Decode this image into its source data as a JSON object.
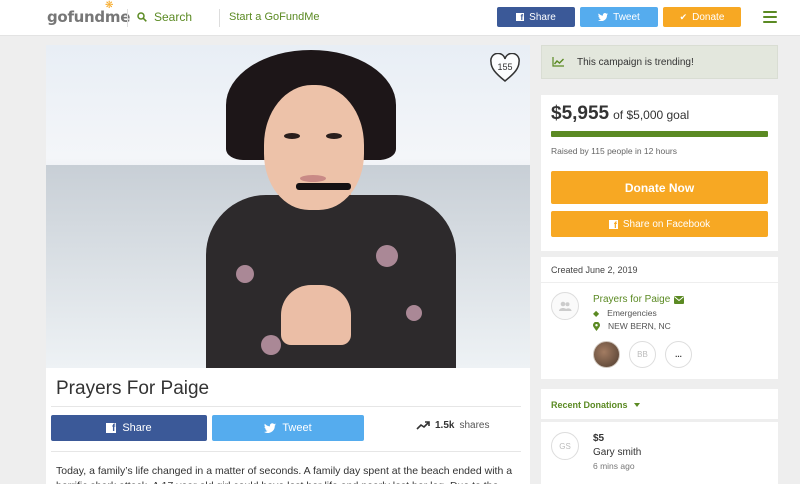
{
  "header": {
    "logo": "gofundme",
    "search_label": "Search",
    "start_label": "Start a GoFundMe",
    "share_label": "Share",
    "tweet_label": "Tweet",
    "donate_label": "Donate"
  },
  "campaign": {
    "heart_count": "155",
    "title": "Prayers For Paige",
    "share_label": "Share",
    "tweet_label": "Tweet",
    "shares_count": "1.5k",
    "shares_label": "shares",
    "story": "Today, a family’s life changed in a matter of seconds. A family day spent at the beach ended with a horrific shark attack. A 17 year old girl could have lost her life and nearly lost her leg. Due to the"
  },
  "sidebar": {
    "trending": "This campaign is trending!",
    "raised_amount": "$5,955",
    "goal_text": "of $5,000 goal",
    "progress_fraction": 1.0,
    "raised_by": "Raised by 115 people in 12 hours",
    "donate_now": "Donate Now",
    "share_facebook": "Share on Facebook",
    "created": "Created June 2, 2019",
    "organizer_name": "Prayers for Paige",
    "category": "Emergencies",
    "location": "NEW BERN, NC",
    "team_initials": "BB",
    "team_more": "...",
    "recent_donations": "Recent Donations",
    "donor_initials": "GS",
    "donor_amount": "$5",
    "donor_name": "Gary smith",
    "donor_time": "6 mins ago"
  },
  "colors": {
    "brand_green": "#5b8a23",
    "donate_orange": "#f7a823",
    "facebook_blue": "#3b5998",
    "twitter_blue": "#55acee"
  }
}
